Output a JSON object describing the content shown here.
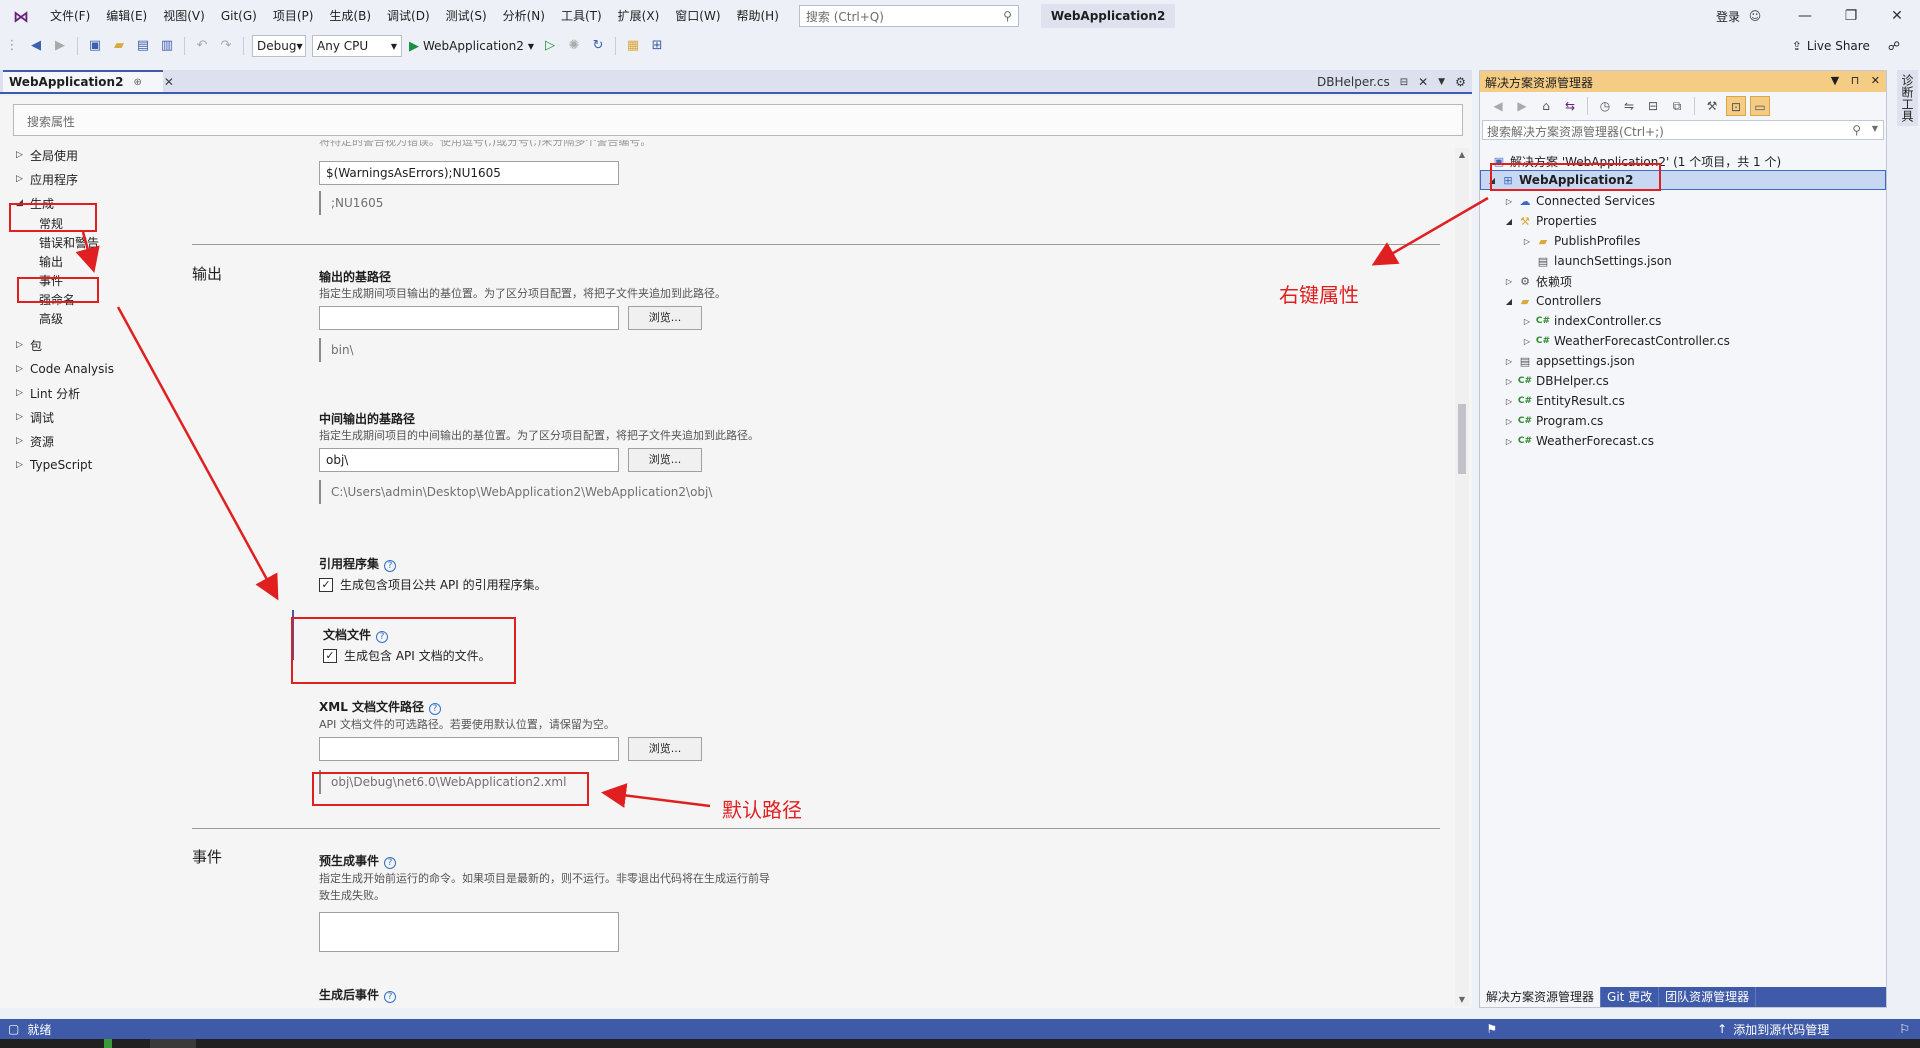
{
  "menubar": {
    "items": [
      "文件(F)",
      "编辑(E)",
      "视图(V)",
      "Git(G)",
      "项目(P)",
      "生成(B)",
      "调试(D)",
      "测试(S)",
      "分析(N)",
      "工具(T)",
      "扩展(X)",
      "窗口(W)",
      "帮助(H)"
    ],
    "search_placeholder": "搜索 (Ctrl+Q)",
    "solution_title": "WebApplication2",
    "login": "登录",
    "window_controls": [
      "—",
      "❐",
      "✕"
    ]
  },
  "toolbar": {
    "config": "Debug",
    "platform": "Any CPU",
    "run_target": "WebApplication2",
    "live_share": "Live Share"
  },
  "tabs": {
    "active": "WebApplication2",
    "preview": "DBHelper.cs"
  },
  "properties": {
    "search_placeholder": "搜索属性",
    "nav": [
      {
        "label": "全局使用",
        "expanded": false
      },
      {
        "label": "应用程序",
        "expanded": false
      },
      {
        "label": "生成",
        "expanded": true
      },
      {
        "label": "包",
        "expanded": false
      },
      {
        "label": "Code Analysis",
        "expanded": false
      },
      {
        "label": "Lint 分析",
        "expanded": false
      },
      {
        "label": "调试",
        "expanded": false
      },
      {
        "label": "资源",
        "expanded": false
      },
      {
        "label": "TypeScript",
        "expanded": false
      }
    ],
    "build_subitems": [
      "常规",
      "错误和警告",
      "输出",
      "事件",
      "强命名",
      "高级"
    ],
    "warnings": {
      "partial_desc": "将特定的警告视为错误。使用逗号(,)或分号(;)来分隔多个警告编号。",
      "value": "$(WarningsAsErrors);NU1605",
      "evaluated": ";NU1605"
    },
    "output_section": {
      "title": "输出",
      "base_path_title": "输出的基路径",
      "base_path_desc": "指定生成期间项目输出的基位置。为了区分项目配置，将把子文件夹追加到此路径。",
      "base_path_value": "",
      "base_path_eval": "bin\\",
      "browse": "浏览...",
      "inter_path_title": "中间输出的基路径",
      "inter_path_desc": "指定生成期间项目的中间输出的基位置。为了区分项目配置，将把子文件夹追加到此路径。",
      "inter_path_value": "obj\\",
      "inter_path_eval": "C:\\Users\\admin\\Desktop\\WebApplication2\\WebApplication2\\obj\\",
      "ref_asm_title": "引用程序集",
      "ref_asm_check": "生成包含项目公共 API 的引用程序集。",
      "doc_file_title": "文档文件",
      "doc_file_check": "生成包含 API 文档的文件。",
      "xml_path_title": "XML 文档文件路径",
      "xml_path_desc": "API 文档文件的可选路径。若要使用默认位置，请保留为空。",
      "xml_path_value": "",
      "xml_path_eval": "obj\\Debug\\net6.0\\WebApplication2.xml"
    },
    "events_section": {
      "title": "事件",
      "prebuild_title": "预生成事件",
      "prebuild_desc_1": "指定生成开始前运行的命令。如果项目是最新的，则不运行。非零退出代码将在生成运行前导",
      "prebuild_desc_2": "致生成失败。",
      "postbuild_title": "生成后事件"
    }
  },
  "solution_explorer": {
    "title": "解决方案资源管理器",
    "search_placeholder": "搜索解决方案资源管理器(Ctrl+;)",
    "solution_label": "解决方案 'WebApplication2' (1 个项目，共 1 个)",
    "project": "WebApplication2",
    "tree": [
      {
        "label": "Connected Services",
        "icon": "connected-services-icon",
        "depth": 1,
        "tri": "▷"
      },
      {
        "label": "Properties",
        "icon": "wrench-folder-icon",
        "depth": 1,
        "tri": "◢"
      },
      {
        "label": "PublishProfiles",
        "icon": "folder-icon",
        "depth": 2,
        "tri": "▷"
      },
      {
        "label": "launchSettings.json",
        "icon": "json-file-icon",
        "depth": 2,
        "tri": ""
      },
      {
        "label": "依赖项",
        "icon": "dependencies-icon",
        "depth": 1,
        "tri": "▷"
      },
      {
        "label": "Controllers",
        "icon": "folder-icon",
        "depth": 1,
        "tri": "◢"
      },
      {
        "label": "indexController.cs",
        "icon": "csharp-file-icon",
        "depth": 2,
        "tri": "▷"
      },
      {
        "label": "WeatherForecastController.cs",
        "icon": "csharp-file-icon",
        "depth": 2,
        "tri": "▷"
      },
      {
        "label": "appsettings.json",
        "icon": "json-file-icon",
        "depth": 1,
        "tri": "▷"
      },
      {
        "label": "DBHelper.cs",
        "icon": "csharp-file-icon",
        "depth": 1,
        "tri": "▷"
      },
      {
        "label": "EntityResult.cs",
        "icon": "csharp-file-icon",
        "depth": 1,
        "tri": "▷"
      },
      {
        "label": "Program.cs",
        "icon": "csharp-file-icon",
        "depth": 1,
        "tri": "▷"
      },
      {
        "label": "WeatherForecast.cs",
        "icon": "csharp-file-icon",
        "depth": 1,
        "tri": "▷"
      }
    ],
    "bottom_tabs": [
      "解决方案资源管理器",
      "Git 更改",
      "团队资源管理器"
    ]
  },
  "right_strip": "诊断工具",
  "statusbar": {
    "ready": "就绪",
    "add_source": "添加到源代码管理"
  },
  "annotations": {
    "right_click": "右键属性",
    "default_path": "默认路径"
  },
  "colors": {
    "accent": "#3f5aa8",
    "annotation": "#e02020",
    "tool_window_header": "#f5cc84"
  }
}
